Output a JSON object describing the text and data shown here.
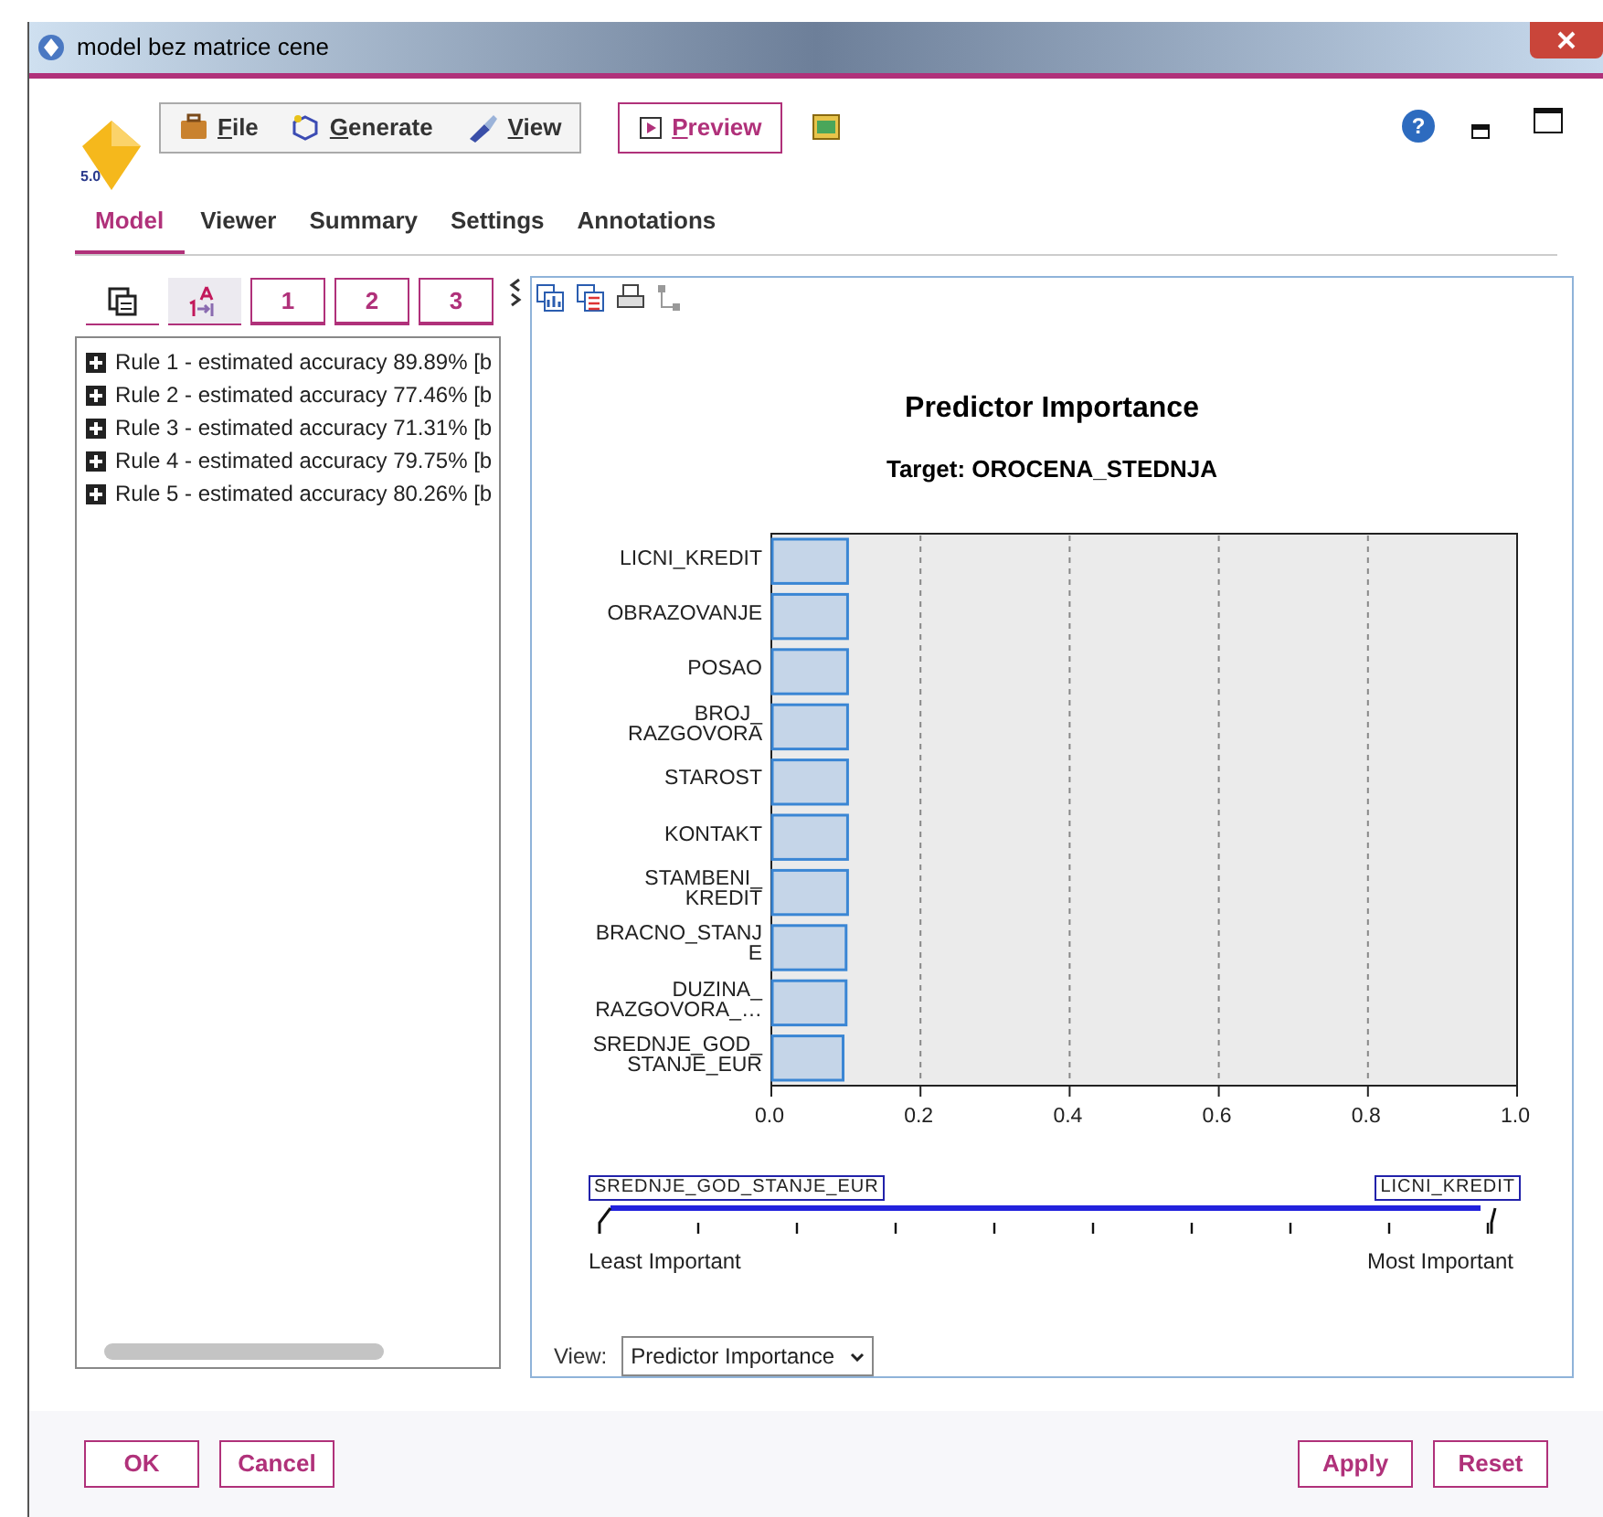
{
  "window": {
    "title": "model bez matrice cene"
  },
  "toolbar": {
    "menus": [
      {
        "label": "File",
        "kind": "file"
      },
      {
        "label": "Generate",
        "kind": "generate"
      },
      {
        "label": "View",
        "kind": "view"
      }
    ],
    "preview": "Preview",
    "logo_version": "5.0",
    "help": "?"
  },
  "tabs": [
    {
      "label": "Model",
      "selected": true
    },
    {
      "label": "Viewer",
      "selected": false
    },
    {
      "label": "Summary",
      "selected": false
    },
    {
      "label": "Settings",
      "selected": false
    },
    {
      "label": "Annotations",
      "selected": false
    }
  ],
  "left_panel": {
    "view_toggles": [
      {
        "kind": "rules",
        "selected": false
      },
      {
        "kind": "sort",
        "selected": true
      }
    ],
    "level_buttons": [
      "1",
      "2",
      "3"
    ],
    "rules": [
      {
        "label": "Rule 1 - estimated accuracy 89.89% [b",
        "expanded": false
      },
      {
        "label": "Rule 2 - estimated accuracy 77.46% [b",
        "expanded": false
      },
      {
        "label": "Rule 3 - estimated accuracy 71.31% [b",
        "expanded": false
      },
      {
        "label": "Rule 4 - estimated accuracy 79.75% [b",
        "expanded": false
      },
      {
        "label": "Rule 5 - estimated accuracy 80.26% [b",
        "expanded": false
      }
    ]
  },
  "right_panel": {
    "chart_data": {
      "type": "bar",
      "orientation": "horizontal",
      "title": "Predictor Importance",
      "subtitle": "Target: OROCENA_STEDNJA",
      "categories": [
        "LICNI_KREDIT",
        "OBRAZOVANJE",
        "POSAO",
        "BROJ_\nRAZGOVORA",
        "STAROST",
        "KONTAKT",
        "STAMBENI_\nKREDIT",
        "BRACNO_STANJ\nE",
        "DUZINA_\nRAZGOVORA_…",
        "SREDNJE_GOD_\nSTANJE_EUR"
      ],
      "grid": true,
      "series": [
        {
          "color": "#c5d5e8",
          "values": [
            0.101,
            0.101,
            0.101,
            0.101,
            0.101,
            0.101,
            0.101,
            0.099,
            0.099,
            0.095
          ]
        }
      ],
      "xlim": [
        0,
        1
      ],
      "xticks": [
        {
          "value": 0,
          "label": "0.0"
        },
        {
          "value": 0.2,
          "label": "0.2"
        },
        {
          "value": 0.4,
          "label": "0.4"
        },
        {
          "value": 0.6,
          "label": "0.6"
        },
        {
          "value": 0.8,
          "label": "0.8"
        },
        {
          "value": 1,
          "label": "1.0"
        }
      ]
    },
    "importance_scale": {
      "least_field": "SREDNJE_GOD_STANJE_EUR",
      "most_field": "LICNI_KREDIT",
      "least_label": "Least Important",
      "most_label": "Most Important"
    },
    "view_label": "View:",
    "view_value": "Predictor Importance"
  },
  "buttons_left": [
    "OK",
    "Cancel"
  ],
  "buttons_right": [
    "Apply",
    "Reset"
  ]
}
